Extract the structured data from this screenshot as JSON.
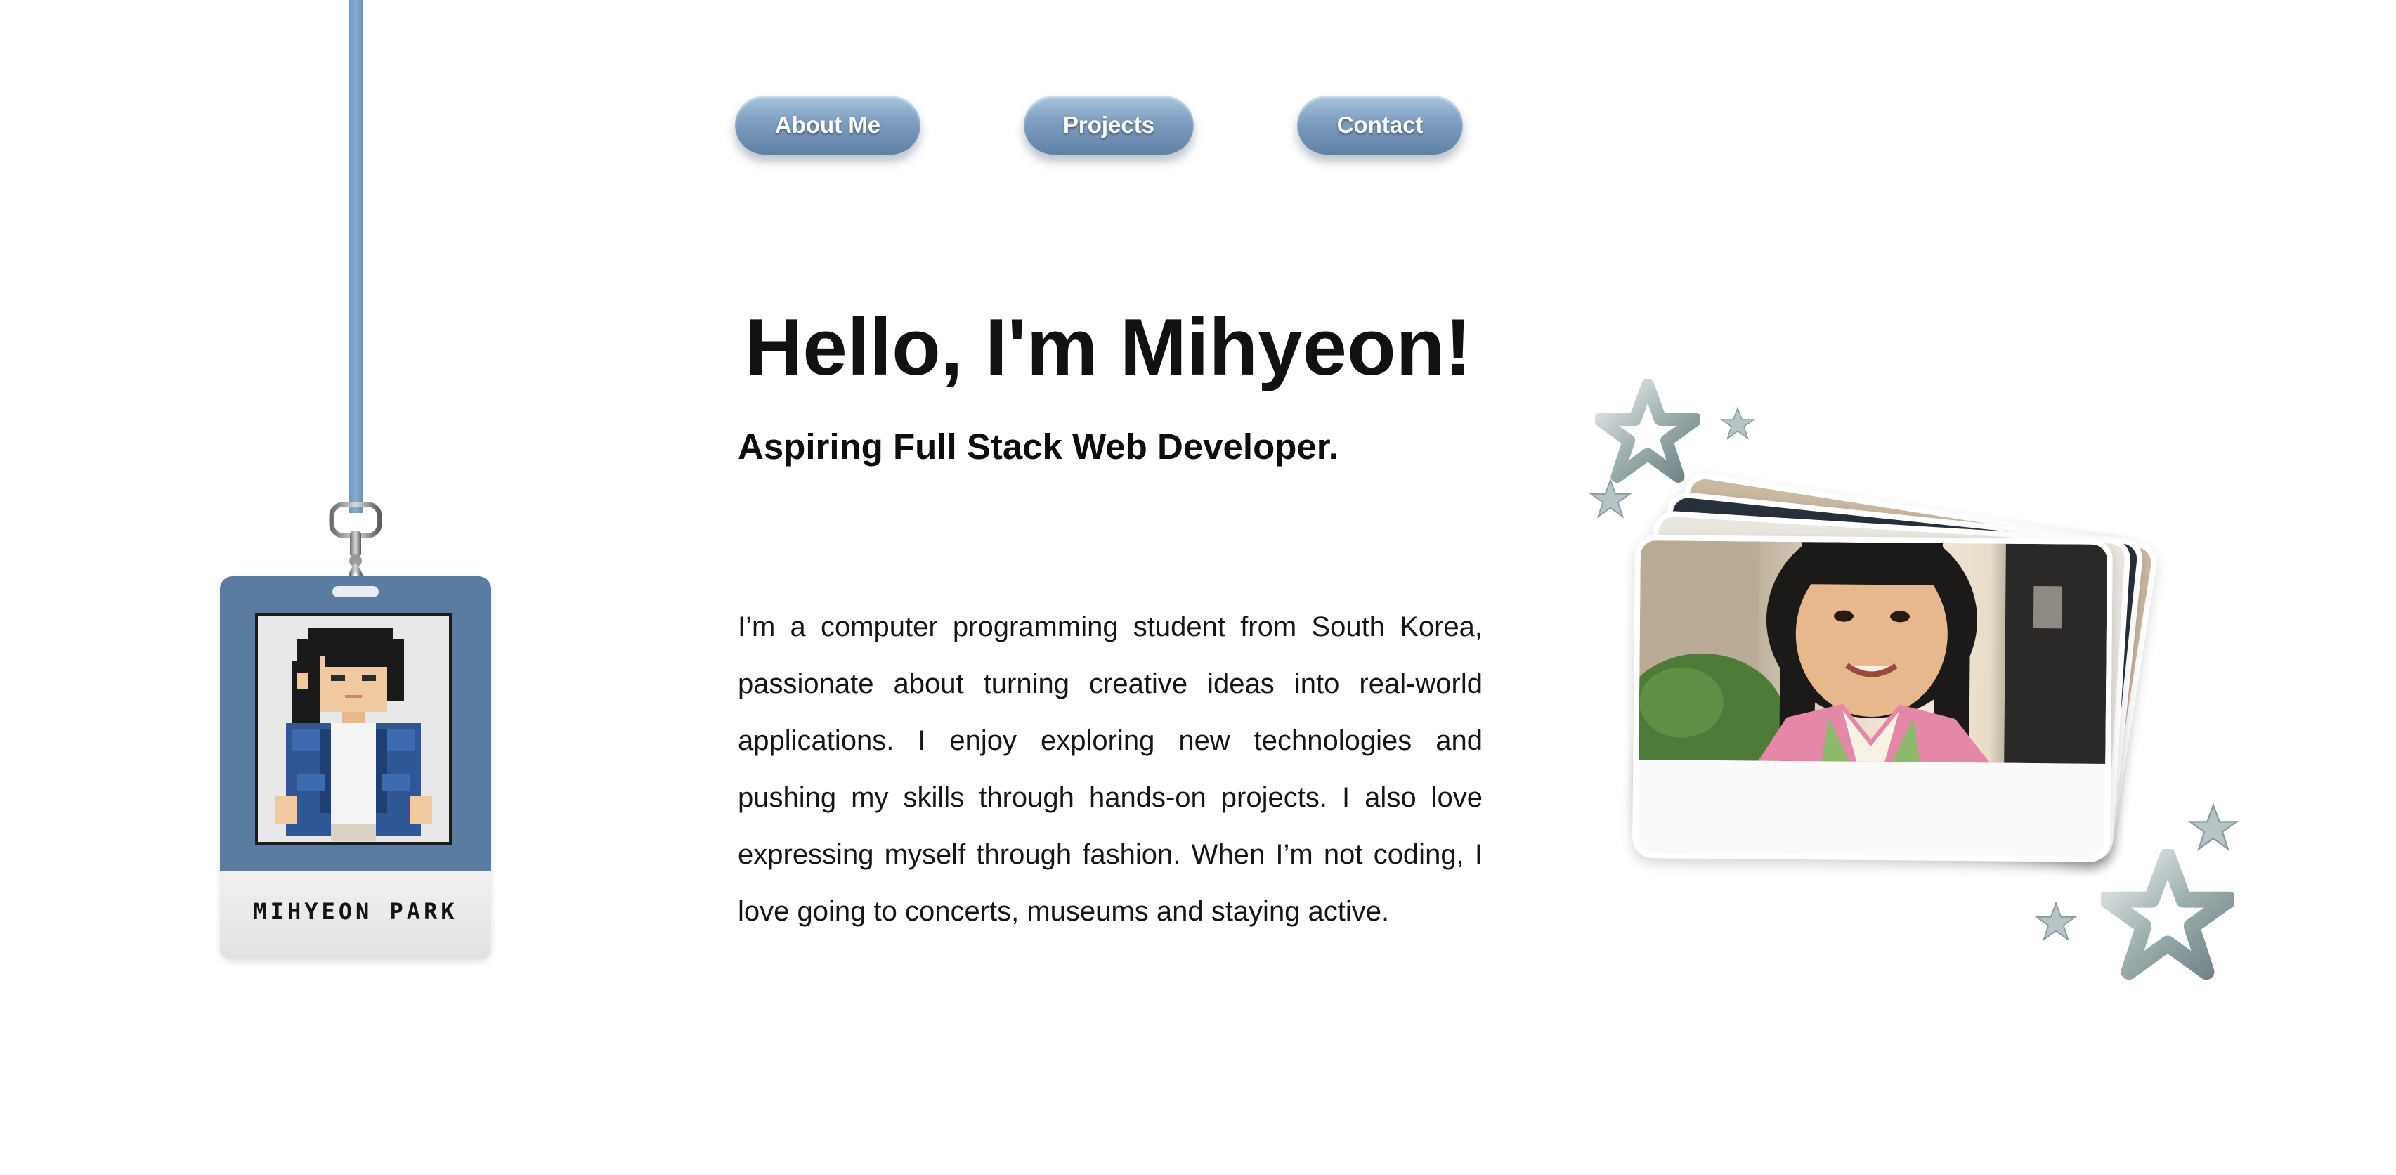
{
  "nav": {
    "about_label": "About Me",
    "projects_label": "Projects",
    "contact_label": "Contact"
  },
  "hero": {
    "title": "Hello, I'm Mihyeon!",
    "subtitle": "Aspiring Full Stack Web Developer.",
    "bio": "I’m a computer programming student from South Korea, passionate about turning creative ideas into real-world applications. I enjoy exploring new technologies and pushing my skills through hands-on projects. I also love expressing myself through fashion. When I’m not coding, I love going to concerts, museums and staying active."
  },
  "badge": {
    "name": "MIHYEON PARK"
  },
  "colors": {
    "lanyard": "#7ea3c6",
    "badge": "#5a7ca1",
    "button": "#7e9ebf",
    "text": "#111111"
  },
  "icons": [
    "lanyard-clip-icon",
    "pixel-avatar-icon",
    "star-icon"
  ]
}
